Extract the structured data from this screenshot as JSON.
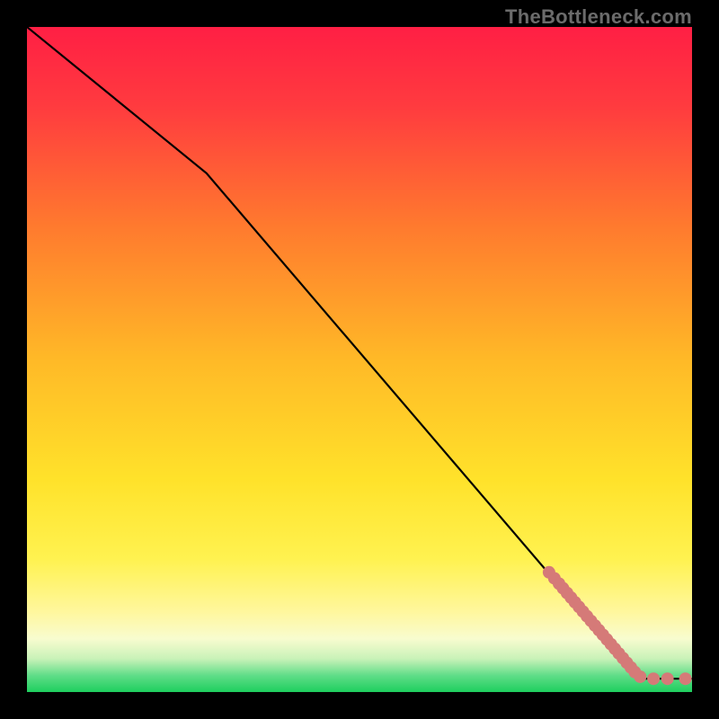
{
  "watermark": "TheBottleneck.com",
  "colors": {
    "background_black": "#000000",
    "gradient_top": "#ff1f44",
    "gradient_mid_orange": "#ff7a2e",
    "gradient_yellow": "#ffe22a",
    "gradient_pale_yellow": "#fff79e",
    "gradient_cream": "#f8fccf",
    "gradient_mint": "#8ee8a0",
    "gradient_green": "#1ecf5e",
    "line_color": "#000000",
    "dot_color": "#d57a78"
  },
  "chart_data": {
    "type": "line",
    "title": "",
    "xlabel": "",
    "ylabel": "",
    "xlim": [
      0,
      100
    ],
    "ylim": [
      0,
      100
    ],
    "series": [
      {
        "name": "curve",
        "x": [
          0,
          27,
          92,
          100
        ],
        "y": [
          100,
          78,
          2,
          2
        ]
      }
    ],
    "scatter": [
      {
        "name": "dots",
        "points": [
          {
            "x": 78.5,
            "y": 18.0
          },
          {
            "x": 79.3,
            "y": 17.1
          },
          {
            "x": 80.0,
            "y": 16.3
          },
          {
            "x": 80.6,
            "y": 15.6
          },
          {
            "x": 81.2,
            "y": 14.9
          },
          {
            "x": 81.8,
            "y": 14.2
          },
          {
            "x": 82.4,
            "y": 13.5
          },
          {
            "x": 83.0,
            "y": 12.8
          },
          {
            "x": 83.6,
            "y": 12.1
          },
          {
            "x": 84.2,
            "y": 11.4
          },
          {
            "x": 84.8,
            "y": 10.7
          },
          {
            "x": 85.4,
            "y": 10.0
          },
          {
            "x": 86.0,
            "y": 9.3
          },
          {
            "x": 86.6,
            "y": 8.6
          },
          {
            "x": 87.2,
            "y": 7.9
          },
          {
            "x": 87.8,
            "y": 7.2
          },
          {
            "x": 88.4,
            "y": 6.5
          },
          {
            "x": 89.0,
            "y": 5.8
          },
          {
            "x": 89.6,
            "y": 5.1
          },
          {
            "x": 90.2,
            "y": 4.4
          },
          {
            "x": 90.8,
            "y": 3.7
          },
          {
            "x": 91.4,
            "y": 3.0
          },
          {
            "x": 92.2,
            "y": 2.3
          },
          {
            "x": 94.2,
            "y": 2.0
          },
          {
            "x": 96.3,
            "y": 2.0
          },
          {
            "x": 99.0,
            "y": 2.0
          }
        ]
      }
    ],
    "gradient_stops": [
      {
        "offset": 0.0,
        "color": "#ff1f44"
      },
      {
        "offset": 0.12,
        "color": "#ff3b3f"
      },
      {
        "offset": 0.3,
        "color": "#ff7a2e"
      },
      {
        "offset": 0.5,
        "color": "#ffb927"
      },
      {
        "offset": 0.68,
        "color": "#ffe22a"
      },
      {
        "offset": 0.8,
        "color": "#fff250"
      },
      {
        "offset": 0.88,
        "color": "#fff79e"
      },
      {
        "offset": 0.92,
        "color": "#f8fccf"
      },
      {
        "offset": 0.95,
        "color": "#c9f2b8"
      },
      {
        "offset": 0.975,
        "color": "#60dd88"
      },
      {
        "offset": 1.0,
        "color": "#1ecf5e"
      }
    ]
  }
}
